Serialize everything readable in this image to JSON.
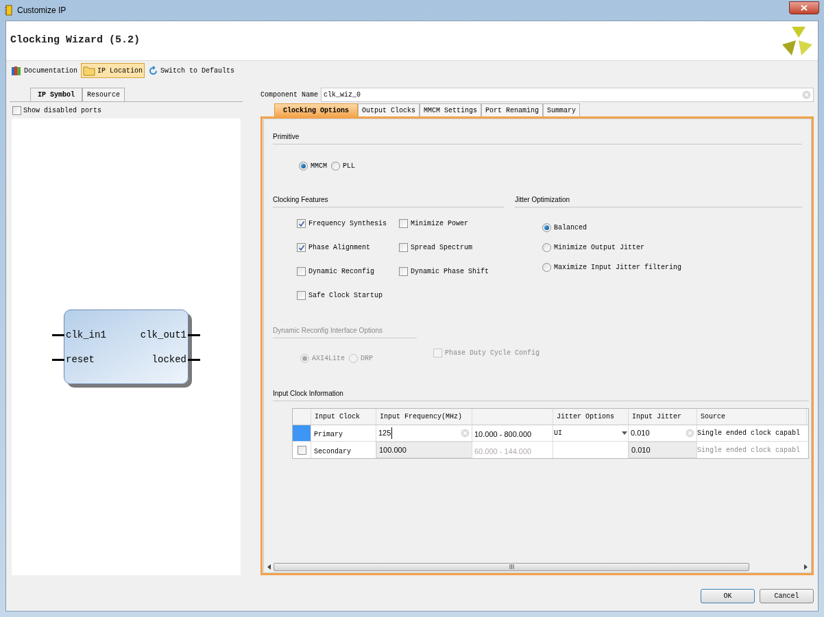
{
  "window": {
    "title": "Customize IP"
  },
  "header": {
    "title": "Clocking Wizard (5.2)"
  },
  "toolbar": [
    {
      "label": "Documentation",
      "selected": false,
      "kind": "books"
    },
    {
      "label": "IP Location",
      "selected": true,
      "kind": "folder"
    },
    {
      "label": "Switch to Defaults",
      "selected": false,
      "kind": "reset"
    }
  ],
  "left_tabs": [
    {
      "label": "IP Symbol",
      "selected": true
    },
    {
      "label": "Resource",
      "selected": false
    }
  ],
  "show_disabled_ports": {
    "label": "Show disabled ports",
    "checked": false
  },
  "symbol": {
    "inputs": [
      "clk_in1",
      "reset"
    ],
    "outputs": [
      "clk_out1",
      "locked"
    ]
  },
  "component_name": {
    "label": "Component Name",
    "value": "clk_wiz_0"
  },
  "tabs": [
    {
      "label": "Clocking Options",
      "selected": true
    },
    {
      "label": "Output Clocks",
      "selected": false
    },
    {
      "label": "MMCM Settings",
      "selected": false
    },
    {
      "label": "Port Renaming",
      "selected": false
    },
    {
      "label": "Summary",
      "selected": false
    }
  ],
  "primitive": {
    "title": "Primitive",
    "options": [
      {
        "label": "MMCM",
        "selected": true
      },
      {
        "label": "PLL",
        "selected": false
      }
    ]
  },
  "clocking_features": {
    "title": "Clocking Features",
    "options": [
      {
        "label": "Frequency Synthesis",
        "checked": true
      },
      {
        "label": "Minimize Power",
        "checked": false
      },
      {
        "label": "Phase Alignment",
        "checked": true
      },
      {
        "label": "Spread Spectrum",
        "checked": false
      },
      {
        "label": "Dynamic Reconfig",
        "checked": false
      },
      {
        "label": "Dynamic Phase Shift",
        "checked": false
      },
      {
        "label": "Safe Clock Startup",
        "checked": false
      }
    ]
  },
  "jitter_optimization": {
    "title": "Jitter Optimization",
    "options": [
      {
        "label": "Balanced",
        "selected": true
      },
      {
        "label": "Minimize Output Jitter",
        "selected": false
      },
      {
        "label": "Maximize Input Jitter filtering",
        "selected": false
      }
    ]
  },
  "dynamic_reconfig": {
    "title": "Dynamic Reconfig Interface Options",
    "disabled": true,
    "options": [
      {
        "label": "AXI4Lite",
        "selected": true
      },
      {
        "label": "DRP",
        "selected": false
      }
    ],
    "phase_duty": {
      "label": "Phase Duty Cycle Config",
      "checked": false
    }
  },
  "input_clock": {
    "title": "Input Clock Information",
    "columns": [
      "Input Clock",
      "Input Frequency(MHz)",
      "Jitter Options",
      "Input Jitter",
      "Source"
    ],
    "rows": [
      {
        "kind": "primary",
        "name": "Primary",
        "frequency": "125",
        "range": "10.000 - 800.000",
        "jitter_option": "UI",
        "jitter": "0.010",
        "source": "Single ended clock capabl"
      },
      {
        "kind": "secondary",
        "checked": false,
        "name": "Secondary",
        "frequency": "100.000",
        "range": "60.000 - 144.000",
        "jitter": "0.010",
        "source": "Single ended clock capabl"
      }
    ]
  },
  "buttons": [
    "OK",
    "Cancel"
  ]
}
